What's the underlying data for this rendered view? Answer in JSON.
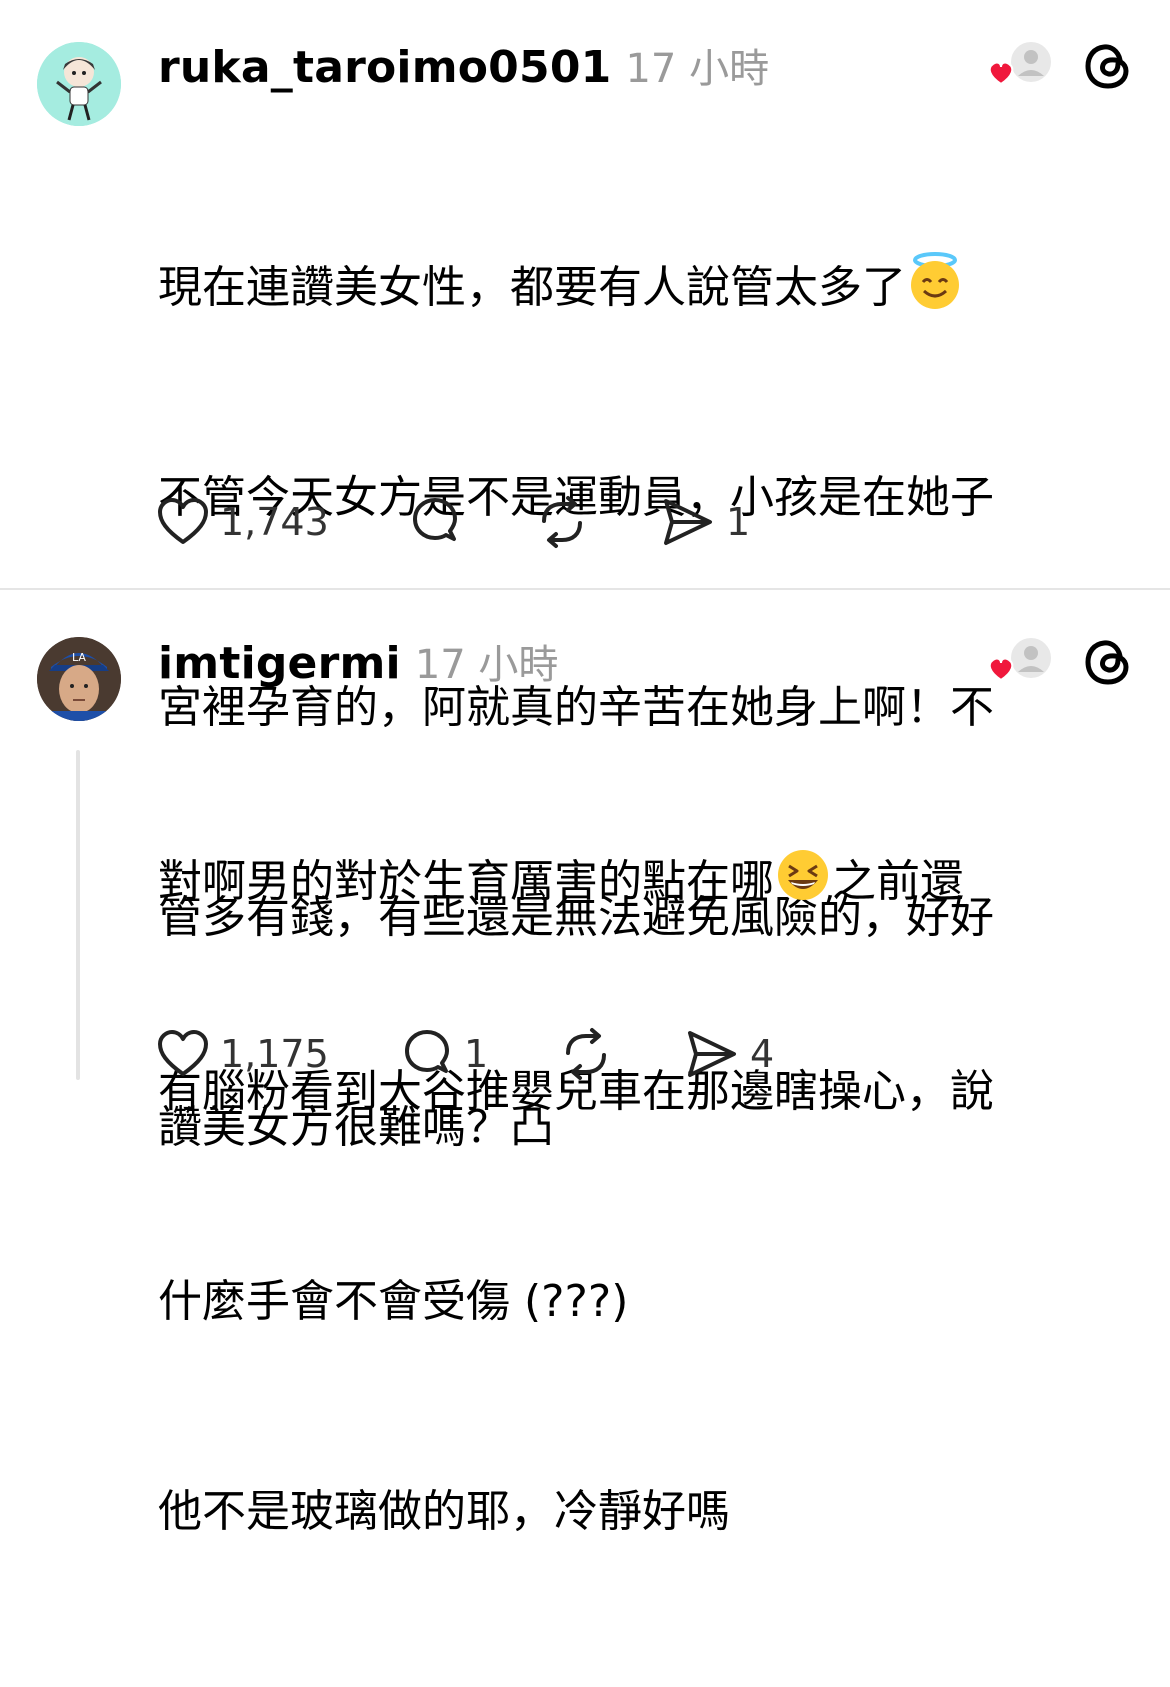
{
  "posts": [
    {
      "username": "ruka_taroimo0501",
      "time": "17 小時",
      "lines": [
        "現在連讚美女性，都要有人說管太多了",
        "不管今天女方是不是運動員，小孩是在她子",
        "宮裡孕育的，阿就真的辛苦在她身上啊！不",
        "管多有錢，有些還是無法避免風險的，好好",
        "讚美女方很難嗎？凸"
      ],
      "emoji": "smiling-face-with-halo",
      "likes": "1,743",
      "comments": "",
      "reposts": "",
      "shares": "1"
    },
    {
      "username": "imtigermi",
      "time": "17 小時",
      "line1_before": "對啊男的對於生育厲害的點在哪",
      "line1_after": "之前還",
      "lines": [
        "有腦粉看到大谷推嬰兒車在那邊瞎操心，說",
        "什麼手會不會受傷 (???)",
        "他不是玻璃做的耶，冷靜好嗎"
      ],
      "emoji": "grinning-squinting-face",
      "likes": "1,175",
      "comments": "1",
      "reposts": "",
      "shares": "4"
    }
  ],
  "colors": {
    "heart": "#f0183c",
    "muted": "#9a9a9a",
    "divider": "#e5e5e5"
  }
}
